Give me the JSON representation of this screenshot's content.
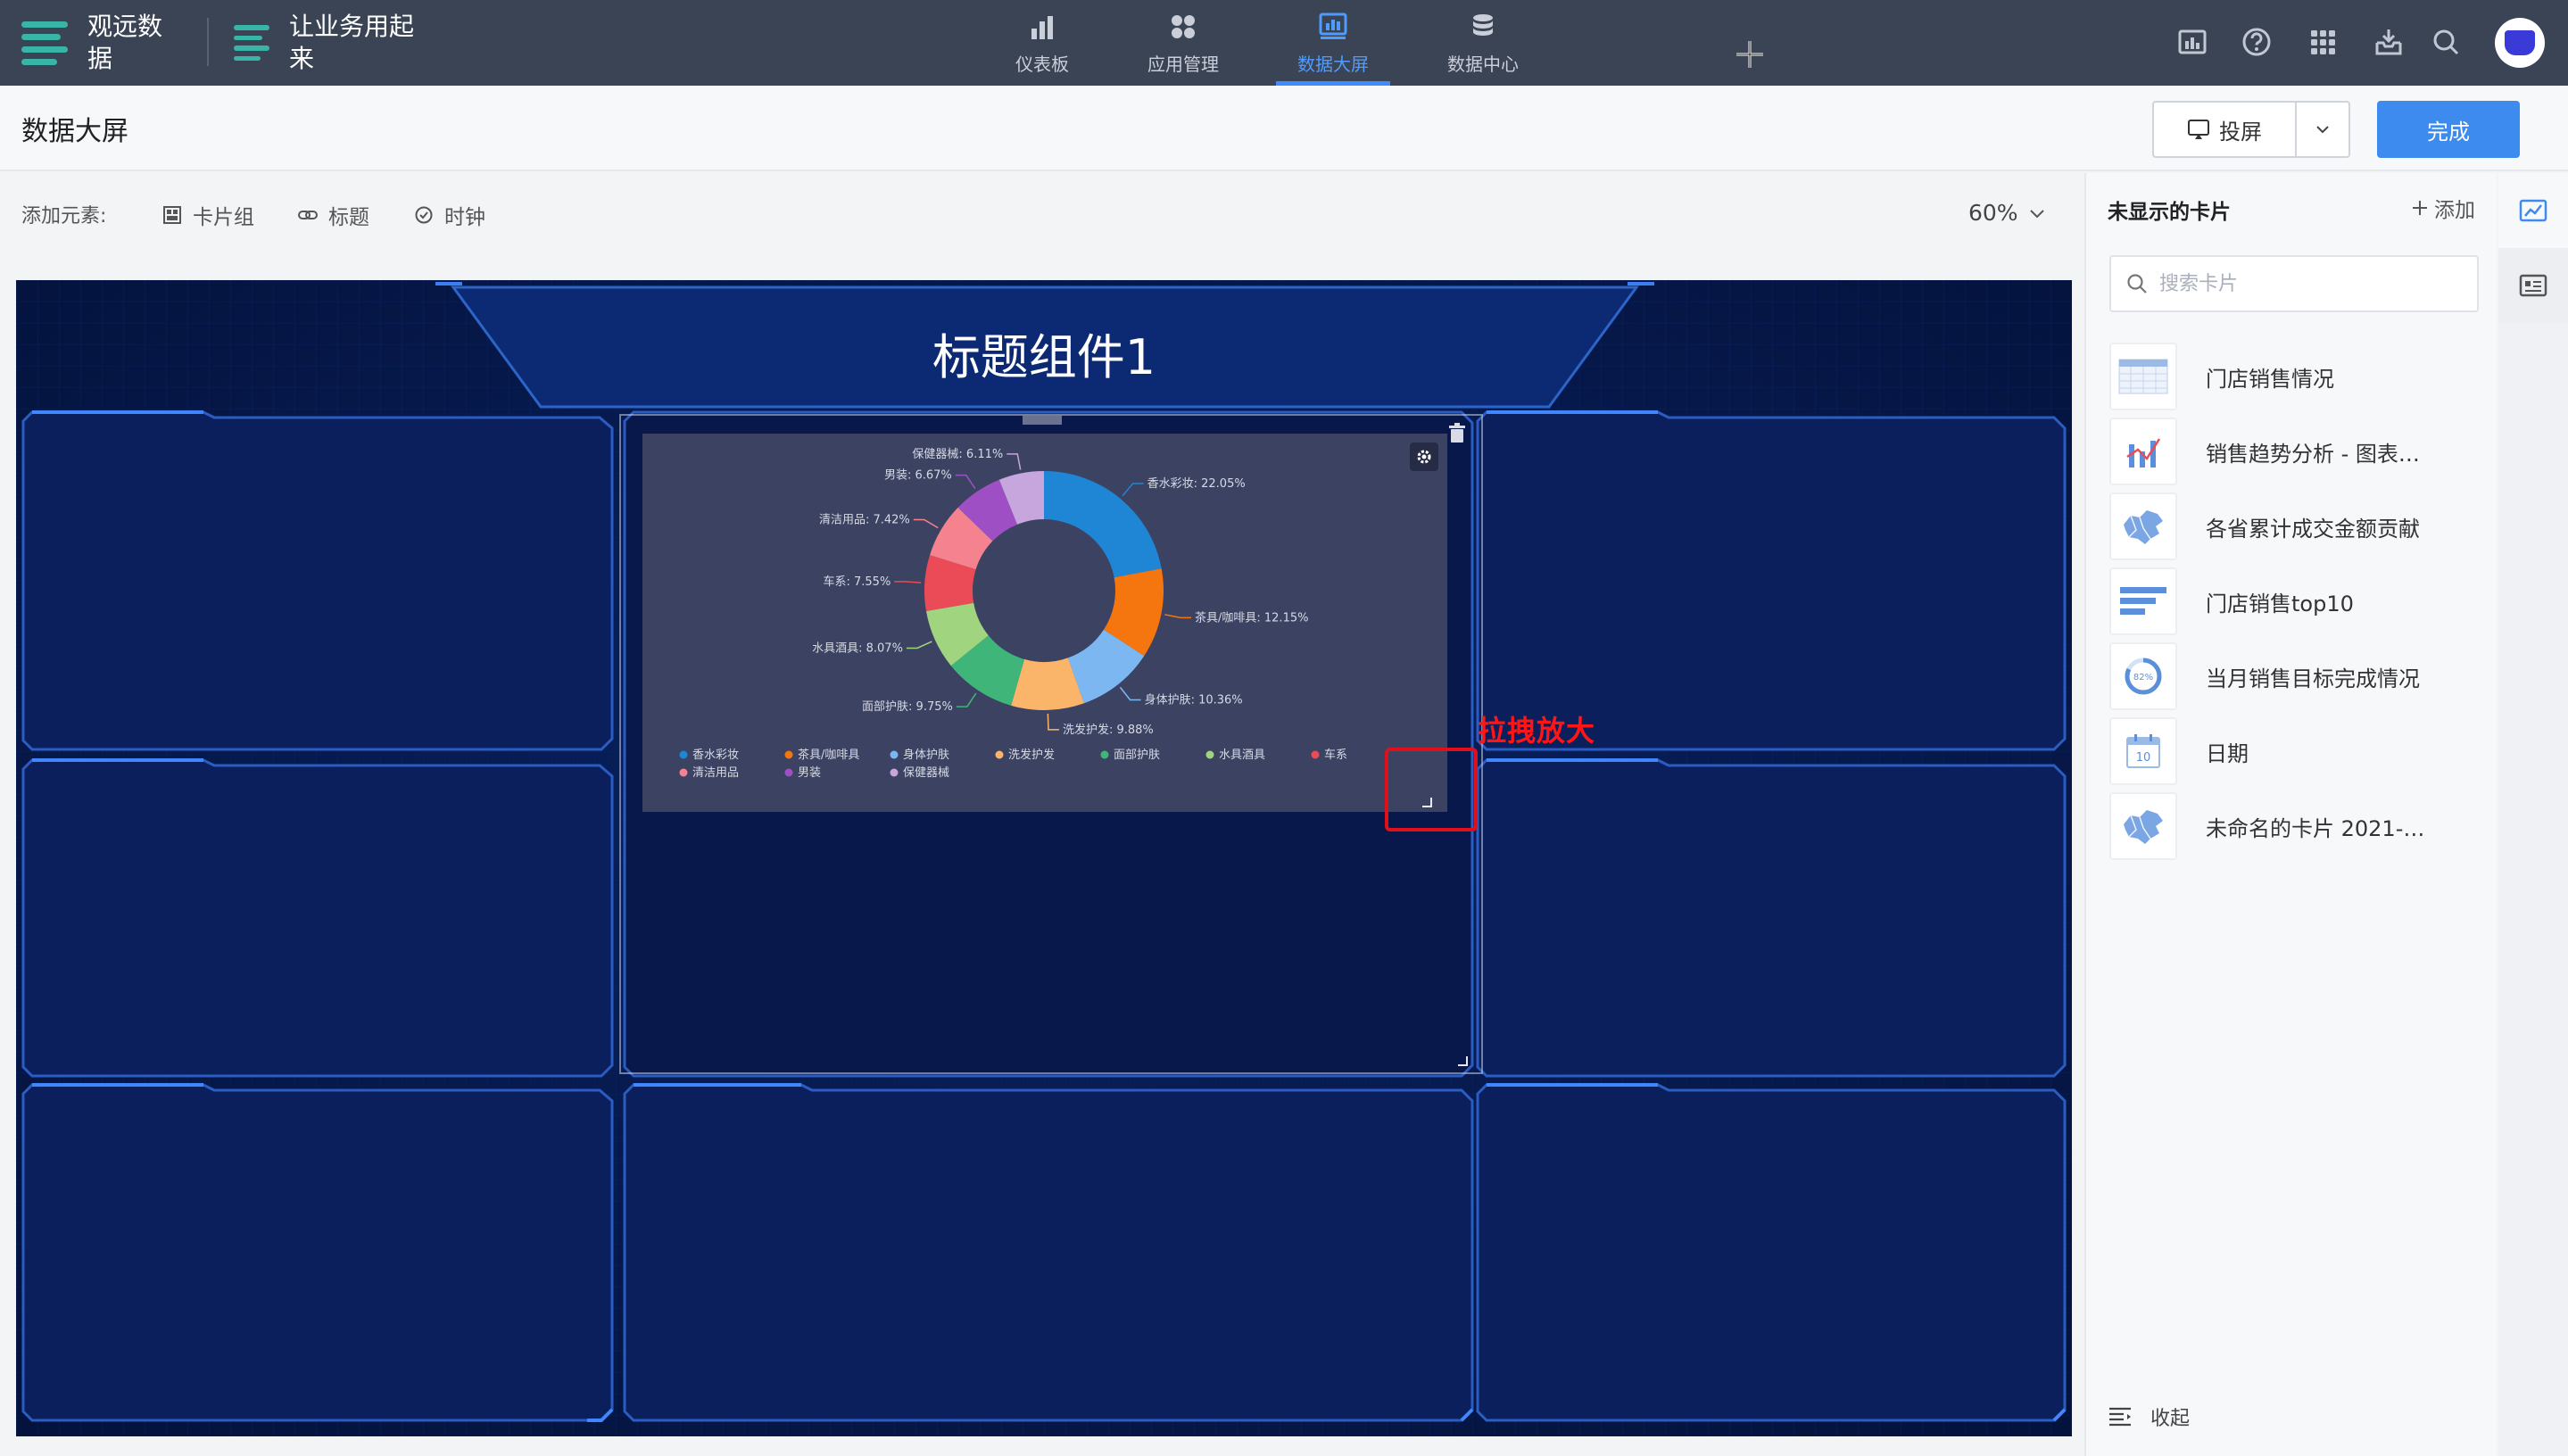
{
  "brand": {
    "product": "观远数据",
    "workspace": "让业务用起来"
  },
  "nav": {
    "items": [
      {
        "label": "仪表板",
        "icon": "bar-chart-icon"
      },
      {
        "label": "应用管理",
        "icon": "apps-icon"
      },
      {
        "label": "数据大屏",
        "icon": "big-screen-icon",
        "active": true
      },
      {
        "label": "数据中心",
        "icon": "database-icon"
      }
    ]
  },
  "header": {
    "page_title": "数据大屏",
    "cast_label": "投屏",
    "done_label": "完成"
  },
  "toolbar": {
    "add_label": "添加元素:",
    "items": [
      "卡片组",
      "标题",
      "时钟"
    ],
    "zoom": "60%"
  },
  "canvas": {
    "title": "标题组件1",
    "annotation": "拉拽放大"
  },
  "chart_data": {
    "type": "pie",
    "donut": true,
    "slices": [
      {
        "name": "香水彩妆",
        "value": 22.05,
        "label": "香水彩妆: 22.05%",
        "color": "#1f86d6"
      },
      {
        "name": "茶具/咖啡具",
        "value": 12.15,
        "label": "茶具/咖啡具: 12.15%",
        "color": "#f5760f"
      },
      {
        "name": "身体护肤",
        "value": 10.36,
        "label": "身体护肤: 10.36%",
        "color": "#7db7f2"
      },
      {
        "name": "洗发护发",
        "value": 9.88,
        "label": "洗发护发: 9.88%",
        "color": "#fbb56b"
      },
      {
        "name": "面部护肤",
        "value": 9.75,
        "label": "面部护肤: 9.75%",
        "color": "#3fb57a"
      },
      {
        "name": "水具酒具",
        "value": 8.07,
        "label": "水具酒具: 8.07%",
        "color": "#a1d47f"
      },
      {
        "name": "车系",
        "value": 7.55,
        "label": "车系: 7.55%",
        "color": "#ea4b57"
      },
      {
        "name": "清洁用品",
        "value": 7.42,
        "label": "清洁用品: 7.42%",
        "color": "#f5828f"
      },
      {
        "name": "男装",
        "value": 6.67,
        "label": "男装: 6.67%",
        "color": "#9f4fc4"
      },
      {
        "name": "保健器械",
        "value": 6.11,
        "label": "保健器械: 6.11%",
        "color": "#c7a5dd"
      }
    ],
    "legend_position": "bottom"
  },
  "right_panel": {
    "title": "未显示的卡片",
    "add_label": "添加",
    "search_placeholder": "搜索卡片",
    "cards": [
      {
        "name": "门店销售情况",
        "icon": "table-icon"
      },
      {
        "name": "销售趋势分析 - 图表…",
        "icon": "bar-line-chart-icon"
      },
      {
        "name": "各省累计成交金额贡献",
        "icon": "china-map-icon"
      },
      {
        "name": "门店销售top10",
        "icon": "horizontal-bar-icon"
      },
      {
        "name": "当月销售目标完成情况",
        "icon": "gauge-percent-icon",
        "badge": "82%"
      },
      {
        "name": "日期",
        "icon": "calendar-icon",
        "badge": "10"
      },
      {
        "name": "未命名的卡片 2021-…",
        "icon": "china-map-icon"
      }
    ],
    "collapse_label": "收起"
  }
}
